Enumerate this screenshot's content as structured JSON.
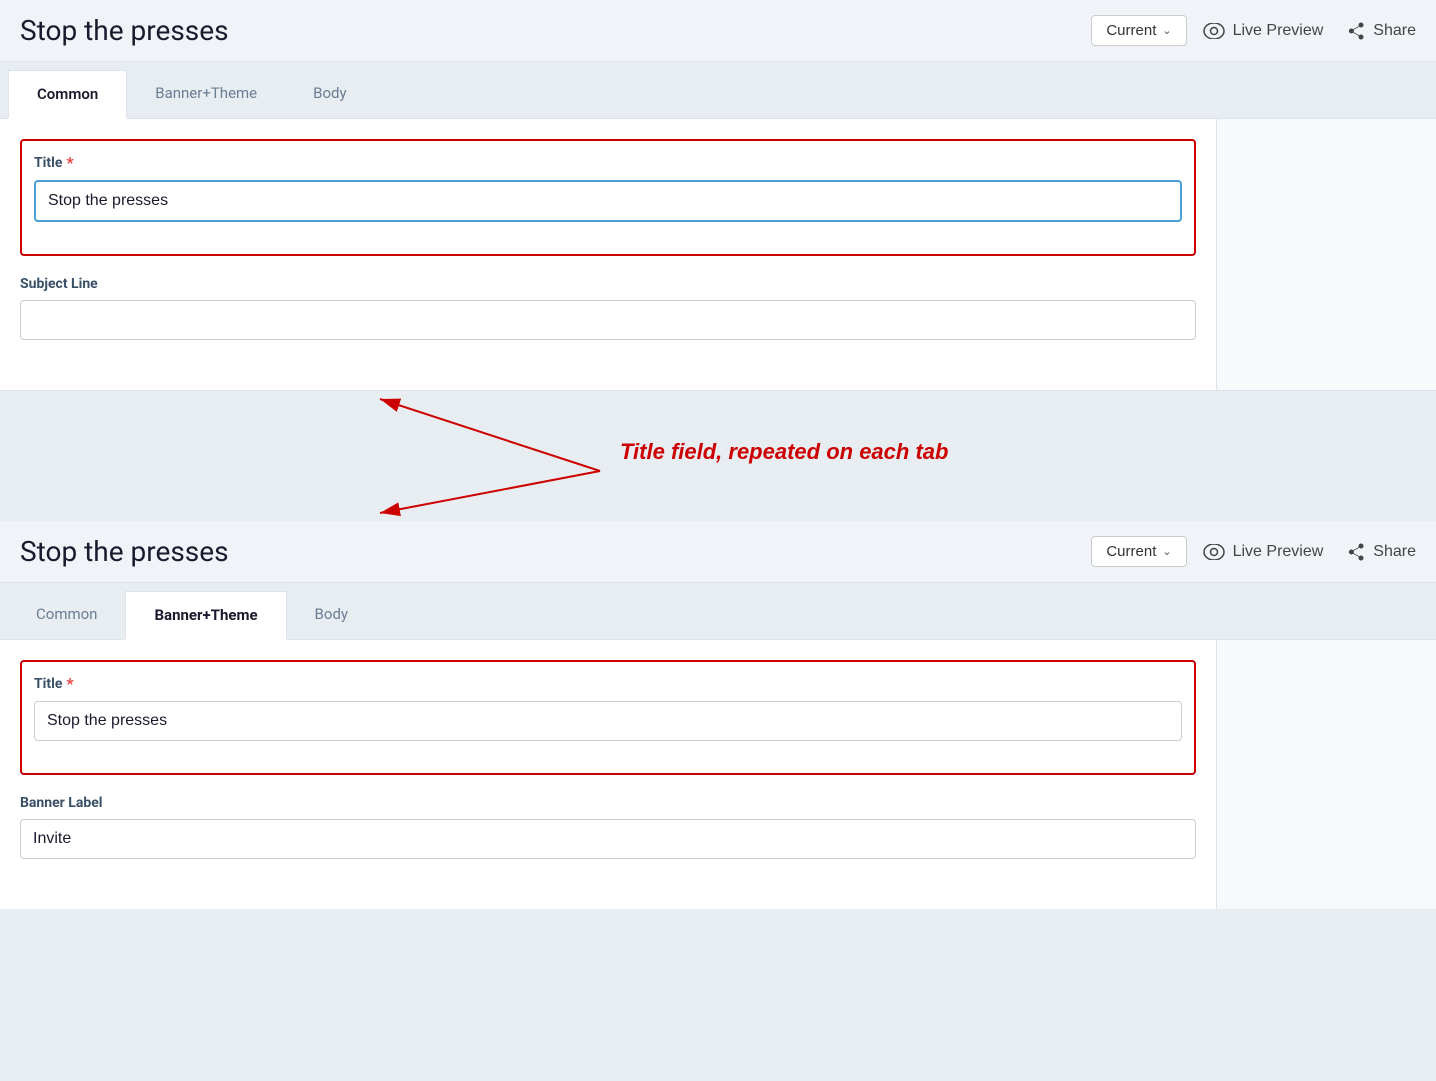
{
  "app": {
    "title": "Stop the presses"
  },
  "header": {
    "title": "Stop the presses",
    "dropdown_label": "Current",
    "live_preview_label": "Live Preview",
    "share_label": "Share"
  },
  "tabs_top": {
    "items": [
      {
        "label": "Common",
        "active": true
      },
      {
        "label": "Banner+Theme",
        "active": false
      },
      {
        "label": "Body",
        "active": false
      }
    ]
  },
  "tabs_bottom": {
    "items": [
      {
        "label": "Common",
        "active": false
      },
      {
        "label": "Banner+Theme",
        "active": true
      },
      {
        "label": "Body",
        "active": false
      }
    ]
  },
  "form_top": {
    "title_label": "Title",
    "title_required": "*",
    "title_value": "Stop the presses",
    "subject_line_label": "Subject Line",
    "subject_line_value": ""
  },
  "form_bottom": {
    "title_label": "Title",
    "title_required": "*",
    "title_value": "Stop the presses",
    "banner_label_label": "Banner Label",
    "banner_label_value": "Invite"
  },
  "annotation": {
    "text": "Title field, repeated on each tab"
  }
}
